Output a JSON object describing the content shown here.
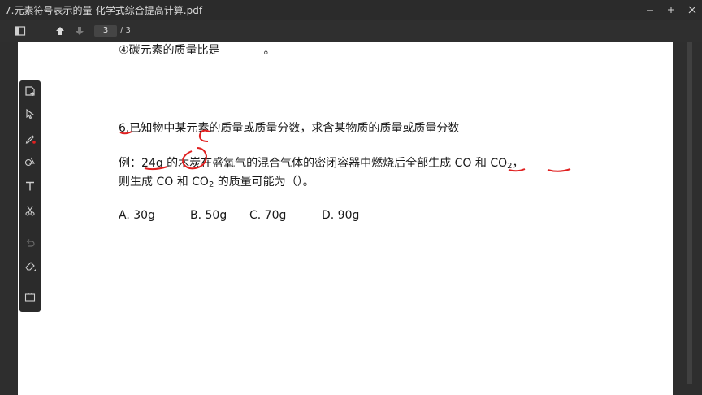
{
  "window": {
    "title": "7.元素符号表示的量-化学式综合提高计算.pdf",
    "controls": [
      "minimize-icon",
      "restore-icon",
      "close-icon"
    ]
  },
  "toolbar": {
    "current_page": "3",
    "total_pages": "/ 3",
    "icons": [
      "sidebar-toggle-icon",
      "page-up-icon",
      "page-down-icon"
    ]
  },
  "tools": [
    "add-page-icon",
    "select-cursor-icon",
    "pen-icon",
    "shapes-icon",
    "text-icon",
    "scissors-icon",
    "undo-icon",
    "eraser-icon",
    "toolbox-icon"
  ],
  "document": {
    "line1_prefix": "④碳元素的质量比是",
    "line1_suffix": "。",
    "heading": "6.已知物中某元素的质量或质量分数，求含某物质的质量或质量分数",
    "example_prefix": "例：",
    "example_mass": "24g",
    "example_mid": " 的木炭在盛氧气的混合气体的密闭容器中燃烧后全部生成 ",
    "co": "CO",
    "and": " 和 ",
    "co2_base": "CO",
    "co2_sub": "2",
    "comma": "，",
    "line2_prefix": "则生成 CO 和 CO",
    "line2_sub": "2",
    "line2_suffix": " 的质量可能为（）。",
    "options": [
      "A. 30g",
      "B. 50g",
      "C. 70g",
      "D. 90g"
    ]
  },
  "annotation": {
    "handwritten_letter": "C",
    "ink_color": "#e02020"
  },
  "colors": {
    "titlebar": "#2b2b2b",
    "toolbar": "#2f2f2f",
    "page": "#ffffff",
    "tool_active_dot": "#e02020"
  }
}
